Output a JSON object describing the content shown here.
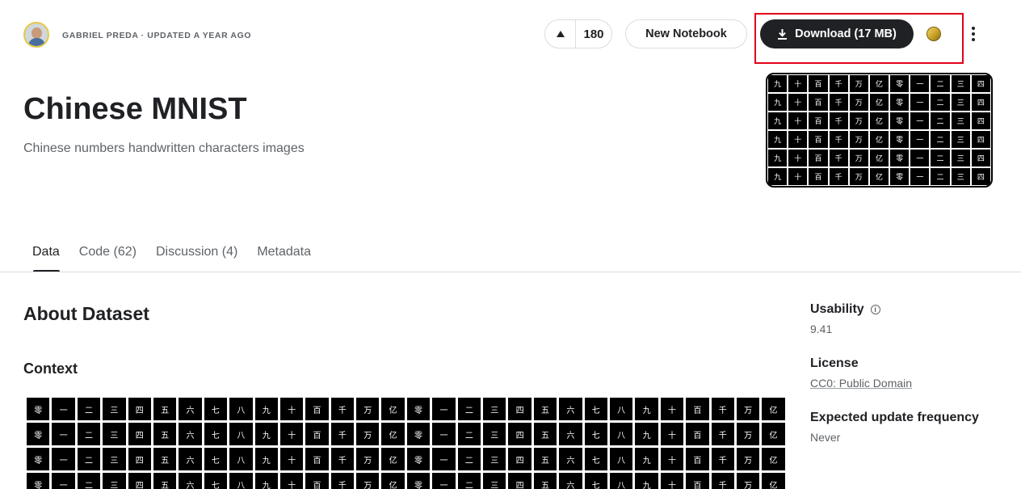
{
  "header": {
    "author_line": "GABRIEL PREDA · UPDATED A YEAR AGO",
    "upvote_count": "180",
    "new_notebook_label": "New Notebook",
    "download_label": "Download (17 MB)"
  },
  "dataset": {
    "title": "Chinese MNIST",
    "subtitle": "Chinese numbers handwritten characters images"
  },
  "tabs": [
    {
      "label": "Data",
      "active": true
    },
    {
      "label": "Code (62)",
      "active": false
    },
    {
      "label": "Discussion (4)",
      "active": false
    },
    {
      "label": "Metadata",
      "active": false
    }
  ],
  "about": {
    "heading": "About Dataset",
    "context_heading": "Context"
  },
  "sidebar": {
    "usability_label": "Usability",
    "usability_value": "9.41",
    "license_label": "License",
    "license_value": "CC0: Public Domain",
    "frequency_label": "Expected update frequency",
    "frequency_value": "Never"
  },
  "icons": {
    "upvote": "triangle-up-icon",
    "download": "download-icon",
    "medal": "gold-medal-icon",
    "more": "kebab-menu-icon",
    "info": "info-icon"
  },
  "colors": {
    "primary_button": "#202124",
    "highlight_border": "#e2001a",
    "medal_gold": "#c9a227"
  }
}
